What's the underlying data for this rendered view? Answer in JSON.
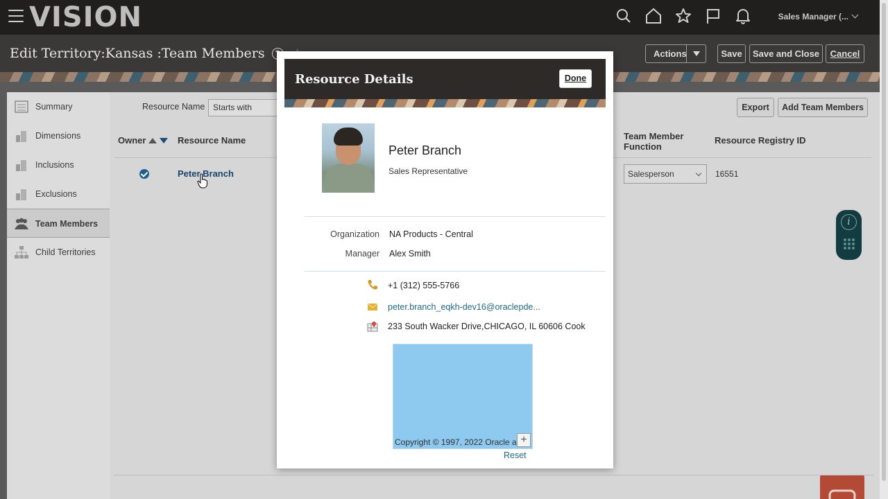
{
  "header": {
    "logo": "VISION",
    "user_menu": "Sales Manager (..."
  },
  "page": {
    "title": "Edit Territory:Kansas :Team Members",
    "help": "?",
    "actions_label": "Actions",
    "save_label": "Save",
    "save_close_label": "Save and Close",
    "cancel_label": "Cancel"
  },
  "sidebar": {
    "items": [
      {
        "label": "Summary"
      },
      {
        "label": "Dimensions"
      },
      {
        "label": "Inclusions"
      },
      {
        "label": "Exclusions"
      },
      {
        "label": "Team Members"
      },
      {
        "label": "Child Territories"
      }
    ]
  },
  "main": {
    "filter_label": "Resource Name",
    "filter_value": "Starts with",
    "export_label": "Export",
    "add_label": "Add Team Members",
    "columns": {
      "owner": "Owner",
      "resource_name": "Resource Name",
      "function": "Team Member Function",
      "registry": "Resource Registry ID"
    },
    "row": {
      "name": "Peter Branch",
      "function": "Salesperson",
      "registry_id": "16551"
    }
  },
  "info_panel": {
    "i": "i"
  },
  "modal": {
    "title": "Resource Details",
    "done_label": "Done",
    "name": "Peter Branch",
    "role": "Sales Representative",
    "organization_label": "Organization",
    "organization": "NA Products - Central",
    "manager_label": "Manager",
    "manager": "Alex Smith",
    "phone": "+1 (312) 555-5766",
    "email": "peter.branch_eqkh-dev16@oraclepde...",
    "address": "233 South Wacker Drive,CHICAGO, IL 60606 Cook",
    "map_copyright": "Copyright © 1997, 2022 Oracle a",
    "map_plus": "+",
    "reset_label": "Reset"
  },
  "colors": {
    "header_bg": "#201f1e",
    "link": "#1e6b8b",
    "owner_check": "#1f5e93"
  }
}
